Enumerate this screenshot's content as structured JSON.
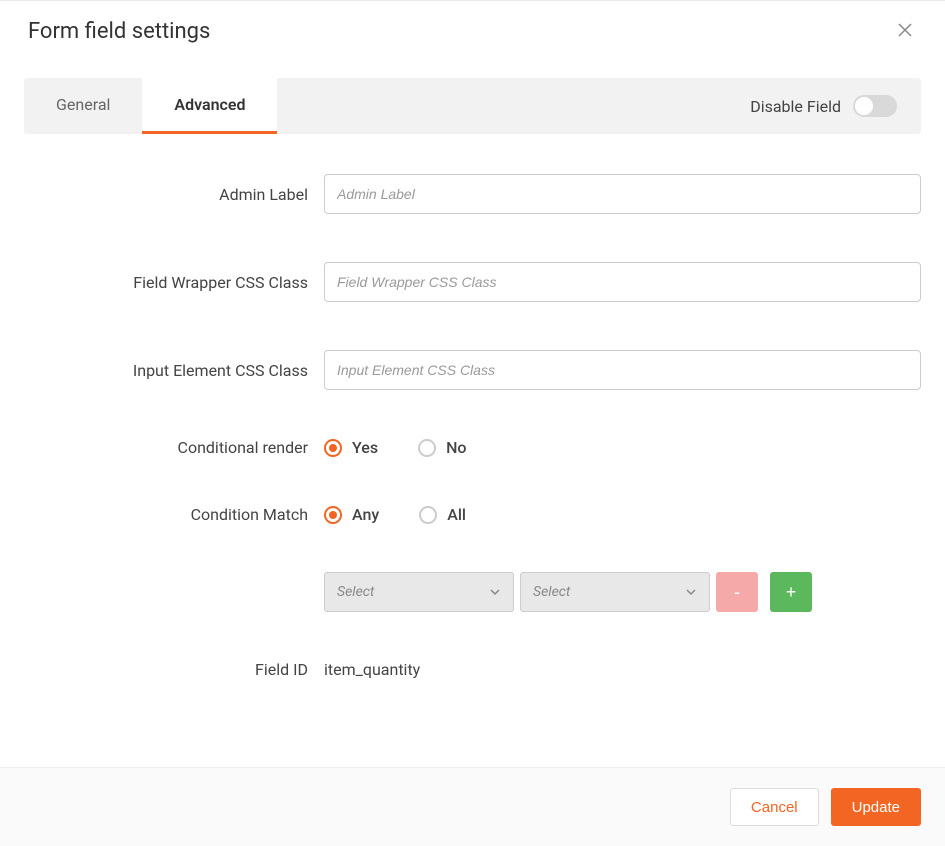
{
  "header": {
    "title": "Form field settings"
  },
  "tabs": {
    "general": "General",
    "advanced": "Advanced"
  },
  "disableField": {
    "label": "Disable Field"
  },
  "fields": {
    "adminLabel": {
      "label": "Admin Label",
      "placeholder": "Admin Label",
      "value": ""
    },
    "wrapperClass": {
      "label": "Field Wrapper CSS Class",
      "placeholder": "Field Wrapper CSS Class",
      "value": ""
    },
    "inputClass": {
      "label": "Input Element CSS Class",
      "placeholder": "Input Element CSS Class",
      "value": ""
    },
    "conditionalRender": {
      "label": "Conditional render",
      "options": {
        "yes": "Yes",
        "no": "No"
      }
    },
    "conditionMatch": {
      "label": "Condition Match",
      "options": {
        "any": "Any",
        "all": "All"
      }
    },
    "conditionRule": {
      "selectPlaceholder": "Select",
      "removeLabel": "-",
      "addLabel": "+"
    },
    "fieldId": {
      "label": "Field ID",
      "value": "item_quantity"
    }
  },
  "footer": {
    "cancel": "Cancel",
    "update": "Update"
  }
}
